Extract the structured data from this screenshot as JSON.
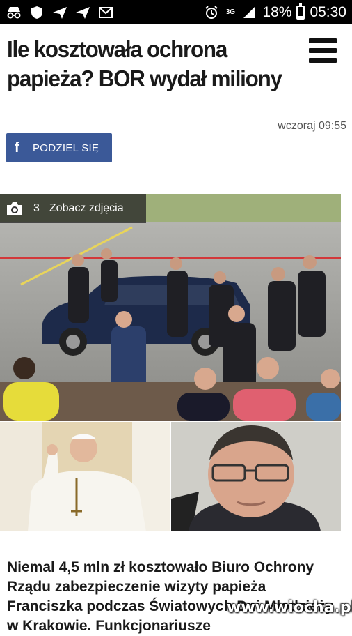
{
  "status_bar": {
    "network": "3G",
    "battery": "18%",
    "battery_level": 0.18,
    "time": "05:30",
    "icons": [
      "incognito-icon",
      "shield-icon",
      "send-icon",
      "send-icon",
      "gmail-icon",
      "alarm-icon",
      "signal-icon",
      "battery-icon"
    ]
  },
  "article": {
    "headline": "Ile kosztowała ochrona papieża? BOR wydał miliony",
    "timestamp": "wczoraj 09:55",
    "share_label": "PODZIEL SIĘ",
    "gallery": {
      "count": "3",
      "label": "Zobacz zdjęcia"
    },
    "lead": "Niemal 4,5 mln zł kosztowało Biuro Ochrony Rządu zabezpieczenie wizyty papieża Franciszka podczas Światowych Dni Młodzieży w Krakowie. Funkcjonariusze"
  },
  "watermark": "www.wiocha.pl",
  "colors": {
    "facebook": "#3b5998",
    "status_bar": "#000000",
    "text": "#1a1a1a"
  }
}
